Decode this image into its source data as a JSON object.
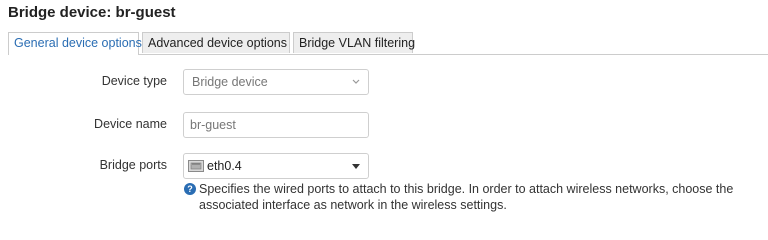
{
  "dialog": {
    "title": "Bridge device: br-guest"
  },
  "tabs": [
    {
      "label": "General device options",
      "active": true
    },
    {
      "label": "Advanced device options",
      "active": false
    },
    {
      "label": "Bridge VLAN filtering",
      "active": false
    }
  ],
  "form": {
    "device_type": {
      "label": "Device type",
      "value": "Bridge device"
    },
    "device_name": {
      "label": "Device name",
      "value": "br-guest"
    },
    "bridge_ports": {
      "label": "Bridge ports",
      "value": "eth0.4",
      "icon": "ethernet-port-icon",
      "help_text": "Specifies the wired ports to attach to this bridge. In order to attach wireless networks, choose the associated interface as network in the wireless settings."
    }
  },
  "colors": {
    "accent": "#2a6db3",
    "tab_inactive_bg": "#eeeeee",
    "border": "#cccccc"
  }
}
